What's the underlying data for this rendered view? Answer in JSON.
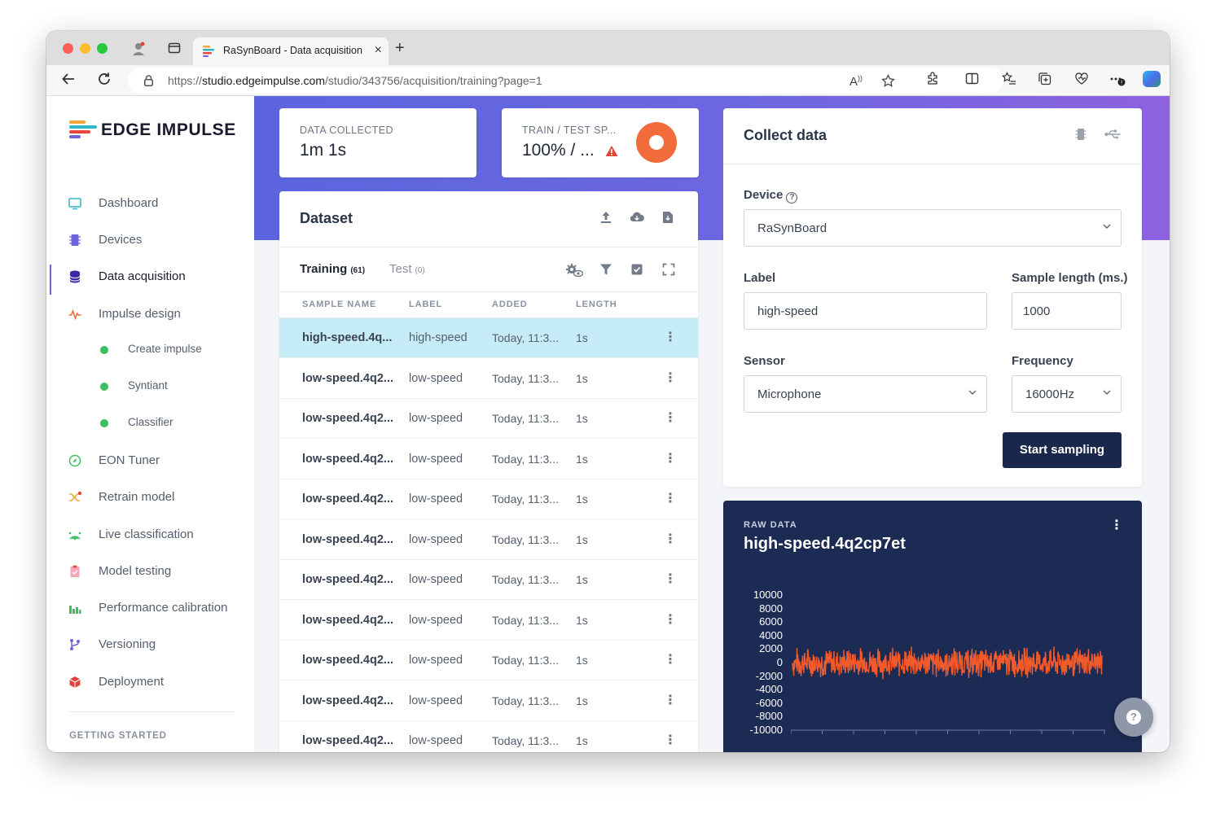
{
  "browser": {
    "tab_title": "RaSynBoard - Data acquisition",
    "url_prefix": "https://",
    "url_host": "studio.edgeimpulse.com",
    "url_path": "/studio/343756/acquisition/training?page=1"
  },
  "sidebar": {
    "logo_text": "EDGE IMPULSE",
    "items": [
      {
        "label": "Dashboard",
        "icon": "monitor-icon"
      },
      {
        "label": "Devices",
        "icon": "chip-icon"
      },
      {
        "label": "Data acquisition",
        "icon": "database-icon"
      },
      {
        "label": "Impulse design",
        "icon": "pulse-icon"
      },
      {
        "label": "EON Tuner",
        "icon": "compass-icon"
      },
      {
        "label": "Retrain model",
        "icon": "shuffle-icon"
      },
      {
        "label": "Live classification",
        "icon": "signal-icon"
      },
      {
        "label": "Model testing",
        "icon": "clipboard-icon"
      },
      {
        "label": "Performance calibration",
        "icon": "chart-icon"
      },
      {
        "label": "Versioning",
        "icon": "branch-icon"
      },
      {
        "label": "Deployment",
        "icon": "cube-icon"
      }
    ],
    "sub_items": [
      "Create impulse",
      "Syntiant",
      "Classifier"
    ],
    "section_title": "GETTING STARTED"
  },
  "stats": {
    "data_collected_label": "DATA COLLECTED",
    "data_collected_value": "1m 1s",
    "split_label": "TRAIN / TEST SP...",
    "split_value": "100% / ..."
  },
  "dataset": {
    "title": "Dataset",
    "tabs": [
      {
        "label": "Training",
        "count": "(61)"
      },
      {
        "label": "Test",
        "count": "(0)"
      }
    ],
    "columns": [
      "SAMPLE NAME",
      "LABEL",
      "ADDED",
      "LENGTH"
    ],
    "rows": [
      {
        "name": "high-speed.4q...",
        "label": "high-speed",
        "added": "Today, 11:3...",
        "length": "1s"
      },
      {
        "name": "low-speed.4q2...",
        "label": "low-speed",
        "added": "Today, 11:3...",
        "length": "1s"
      },
      {
        "name": "low-speed.4q2...",
        "label": "low-speed",
        "added": "Today, 11:3...",
        "length": "1s"
      },
      {
        "name": "low-speed.4q2...",
        "label": "low-speed",
        "added": "Today, 11:3...",
        "length": "1s"
      },
      {
        "name": "low-speed.4q2...",
        "label": "low-speed",
        "added": "Today, 11:3...",
        "length": "1s"
      },
      {
        "name": "low-speed.4q2...",
        "label": "low-speed",
        "added": "Today, 11:3...",
        "length": "1s"
      },
      {
        "name": "low-speed.4q2...",
        "label": "low-speed",
        "added": "Today, 11:3...",
        "length": "1s"
      },
      {
        "name": "low-speed.4q2...",
        "label": "low-speed",
        "added": "Today, 11:3...",
        "length": "1s"
      },
      {
        "name": "low-speed.4q2...",
        "label": "low-speed",
        "added": "Today, 11:3...",
        "length": "1s"
      },
      {
        "name": "low-speed.4q2...",
        "label": "low-speed",
        "added": "Today, 11:3...",
        "length": "1s"
      },
      {
        "name": "low-speed.4q2...",
        "label": "low-speed",
        "added": "Today, 11:3...",
        "length": "1s"
      }
    ]
  },
  "collect": {
    "title": "Collect data",
    "device_label": "Device",
    "device_value": "RaSynBoard",
    "label_label": "Label",
    "label_value": "high-speed",
    "length_label": "Sample length (ms.)",
    "length_value": "1000",
    "sensor_label": "Sensor",
    "sensor_value": "Microphone",
    "frequency_label": "Frequency",
    "frequency_value": "16000Hz",
    "start_button": "Start sampling"
  },
  "raw": {
    "label": "RAW DATA",
    "title": "high-speed.4q2cp7et"
  },
  "chart_data": {
    "type": "line",
    "title": "",
    "xlabel": "",
    "ylabel": "",
    "ylim": [
      -10000,
      10000
    ],
    "y_ticks": [
      "10000",
      "8000",
      "6000",
      "4000",
      "2000",
      "0",
      "-2000",
      "-4000",
      "-6000",
      "-8000",
      "-10000"
    ],
    "series": [
      {
        "color": "#f15a2b",
        "approx_range": [
          -2500,
          2500
        ]
      }
    ]
  },
  "colors": {
    "accent": "#6a66d9",
    "selected_row": "#c6ecf8",
    "primary_button": "#19284a",
    "raw_panel": "#1c2b54",
    "waveform": "#f15a2b",
    "donut": "#f26b3a"
  }
}
